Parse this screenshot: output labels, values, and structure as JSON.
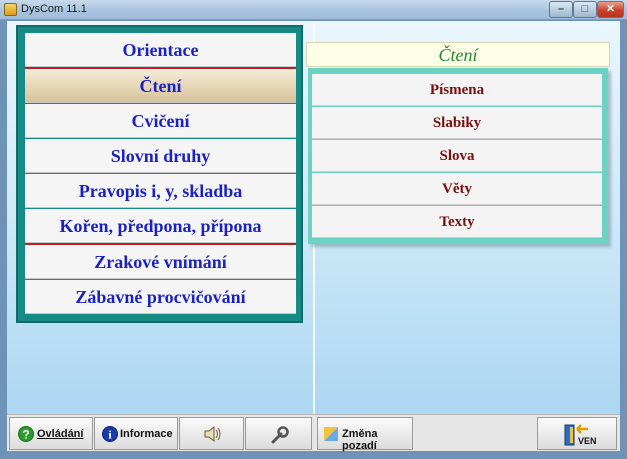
{
  "window": {
    "title": "DysCom 11.1",
    "min": "–",
    "max": "□",
    "close": "✕"
  },
  "left_menu": {
    "items": [
      {
        "label": "Orientace"
      },
      {
        "label": "Čtení"
      },
      {
        "label": "Cvičení"
      },
      {
        "label": "Slovní druhy"
      },
      {
        "label": "Pravopis i, y, skladba"
      },
      {
        "label": "Kořen, předpona, přípona"
      },
      {
        "label": "Zrakové vnímání"
      },
      {
        "label": "Zábavné procvičování"
      }
    ],
    "active": "Čtení"
  },
  "right_panel": {
    "title": "Čtení",
    "items": [
      {
        "label": "Písmena"
      },
      {
        "label": "Slabiky"
      },
      {
        "label": "Slova"
      },
      {
        "label": "Věty"
      },
      {
        "label": "Texty"
      }
    ]
  },
  "toolbar": {
    "help_label": "Ovládání",
    "info_label": "Informace",
    "background_label": "Změna pozadí",
    "exit_label": "VEN"
  },
  "colors": {
    "menu_text": "#1a22c4",
    "submenu_text": "#7a0f0f",
    "panel_teal": "#168a85",
    "title_green": "#1f8a33",
    "accent_red": "#b9202a"
  },
  "icons": {
    "help": "help-circle-icon",
    "info": "info-circle-icon",
    "sound": "speaker-icon",
    "settings": "wrench-icon",
    "background": "palette-icon",
    "exit": "exit-door-icon"
  }
}
